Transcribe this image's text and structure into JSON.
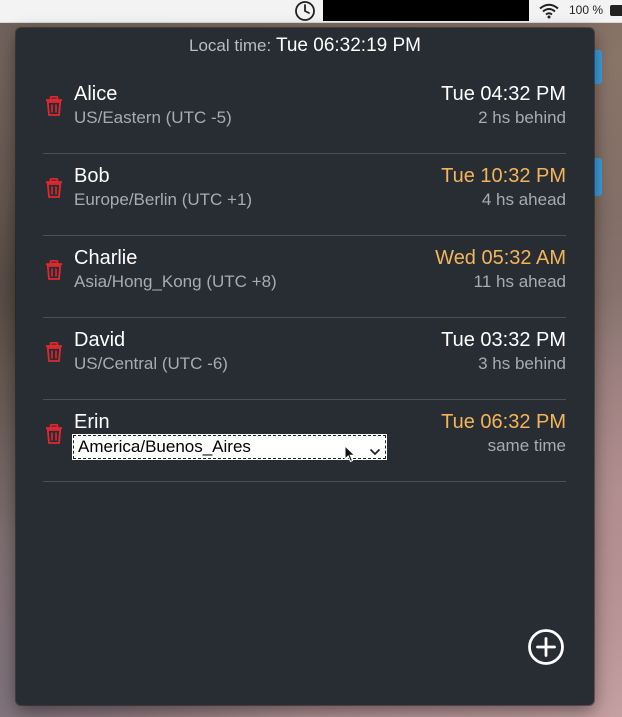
{
  "menubar": {
    "battery_percent": "100 %"
  },
  "popover": {
    "local_time_label": "Local time:",
    "local_time_value": "Tue 06:32:19 PM"
  },
  "contacts": [
    {
      "name": "Alice",
      "zone": "US/Eastern (UTC -5)",
      "time": "Tue 04:32 PM",
      "diff": "2 hs behind",
      "time_color": "#ffffff"
    },
    {
      "name": "Bob",
      "zone": "Europe/Berlin (UTC +1)",
      "time": "Tue 10:32 PM",
      "diff": "4 hs ahead",
      "time_color": "#f4b55a"
    },
    {
      "name": "Charlie",
      "zone": "Asia/Hong_Kong (UTC +8)",
      "time": "Wed 05:32 AM",
      "diff": "11 hs ahead",
      "time_color": "#f4b55a"
    },
    {
      "name": "David",
      "zone": "US/Central (UTC -6)",
      "time": "Tue 03:32 PM",
      "diff": "3 hs behind",
      "time_color": "#ffffff"
    },
    {
      "name": "Erin",
      "zone_select_value": "America/Buenos_Aires",
      "time": "Tue 06:32 PM",
      "diff": "same time",
      "time_color": "#f4b55a"
    }
  ],
  "colors": {
    "accent": "#f4b55a",
    "trash": "#e0282e",
    "panel_bg": "#282c33"
  },
  "icons": {
    "delete": "trash-icon",
    "add": "plus-circle-icon",
    "clock": "clock-icon",
    "wifi": "wifi-icon",
    "battery": "battery-icon"
  }
}
